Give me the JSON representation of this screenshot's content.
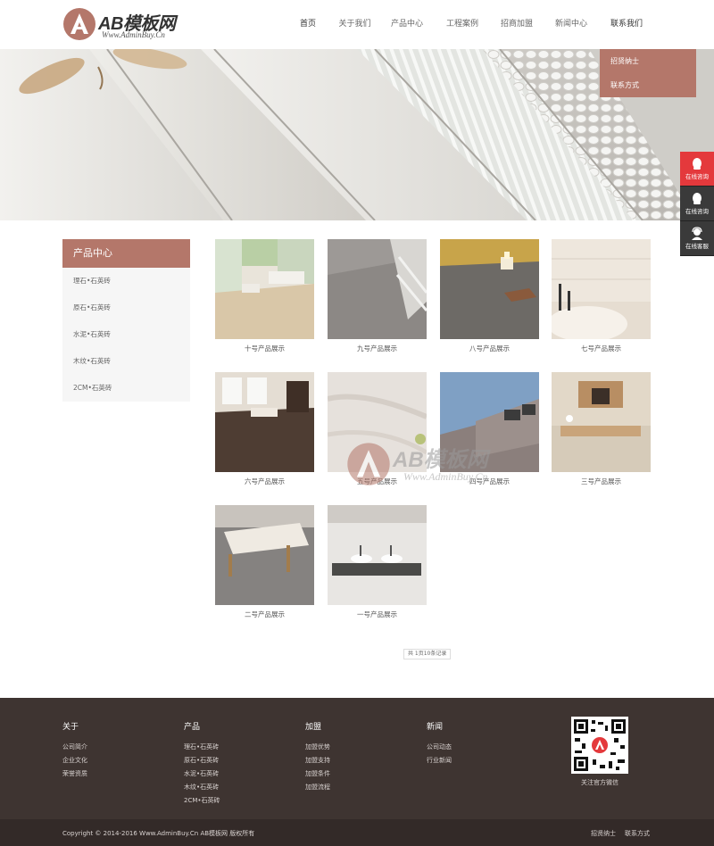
{
  "header": {
    "logo_title": "AB模板网",
    "logo_sub": "Www.AdminBuy.Cn",
    "nav": [
      {
        "label": "首页"
      },
      {
        "label": "关于我们"
      },
      {
        "label": "产品中心"
      },
      {
        "label": "工程案例"
      },
      {
        "label": "招商加盟"
      },
      {
        "label": "新闻中心"
      },
      {
        "label": "联系我们"
      }
    ],
    "dropdown": [
      {
        "label": "招贤纳士"
      },
      {
        "label": "联系方式"
      }
    ]
  },
  "float_bar": [
    {
      "label": "在线咨询",
      "icon": "qq-icon"
    },
    {
      "label": "在线咨询",
      "icon": "qq-icon"
    },
    {
      "label": "在线客服",
      "icon": "service-icon"
    }
  ],
  "category": {
    "title": "产品中心",
    "items": [
      {
        "label": "理石•石英砖"
      },
      {
        "label": "原石•石英砖"
      },
      {
        "label": "水泥•石英砖"
      },
      {
        "label": "木纹•石英砖"
      },
      {
        "label": "2CM•石英砖"
      }
    ]
  },
  "products": [
    {
      "name": "十号产品展示",
      "scene": "living-room"
    },
    {
      "name": "九号产品展示",
      "scene": "marble-floor"
    },
    {
      "name": "八号产品展示",
      "scene": "candles"
    },
    {
      "name": "七号产品展示",
      "scene": "sofa-detail"
    },
    {
      "name": "六号产品展示",
      "scene": "wood-room"
    },
    {
      "name": "五号产品展示",
      "scene": "marble-wall"
    },
    {
      "name": "四号产品展示",
      "scene": "building"
    },
    {
      "name": "三号产品展示",
      "scene": "beige-room"
    },
    {
      "name": "二号产品展示",
      "scene": "lounger"
    },
    {
      "name": "一号产品展示",
      "scene": "sink"
    }
  ],
  "watermark": {
    "title": "AB模板网",
    "sub": "Www.AdminBuy.Cn"
  },
  "pager": {
    "text": "共 1页10条记录"
  },
  "footer": {
    "columns": [
      {
        "title": "关于",
        "links": [
          "公司简介",
          "企业文化",
          "荣誉资质"
        ]
      },
      {
        "title": "产品",
        "links": [
          "理石•石英砖",
          "原石•石英砖",
          "水泥•石英砖",
          "木纹•石英砖",
          "2CM•石英砖"
        ]
      },
      {
        "title": "加盟",
        "links": [
          "加盟优势",
          "加盟支持",
          "加盟条件",
          "加盟流程"
        ]
      },
      {
        "title": "新闻",
        "links": [
          "公司动态",
          "行业新闻"
        ]
      }
    ],
    "qr_label": "关注官方微信",
    "copyright": "Copyright © 2014-2016 Www.AdminBuy.Cn AB模板网 版权所有",
    "bottom_links": [
      "招贤纳士",
      "联系方式"
    ]
  },
  "colors": {
    "accent": "#b4776a",
    "footer_bg": "#3e3431",
    "float_red": "#e4393c"
  }
}
